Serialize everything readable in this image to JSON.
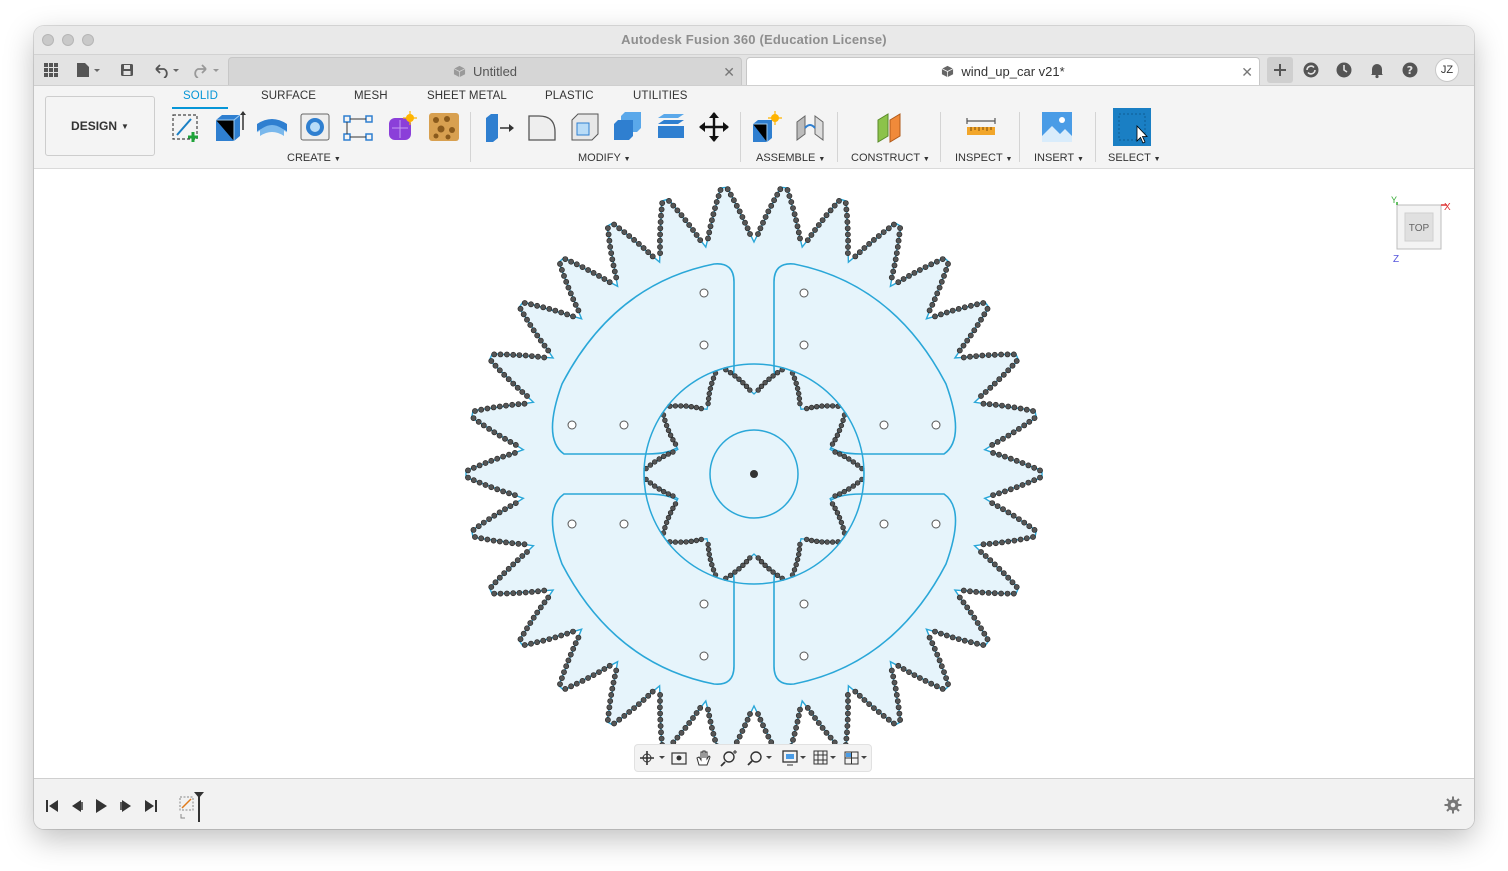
{
  "window": {
    "title": "Autodesk Fusion 360 (Education License)"
  },
  "tabs": [
    {
      "label": "Untitled",
      "active": false
    },
    {
      "label": "wind_up_car v21*",
      "active": true
    }
  ],
  "user": {
    "initials": "JZ"
  },
  "workspace": {
    "label": "DESIGN"
  },
  "ribbon_tabs": [
    {
      "label": "SOLID",
      "active": true
    },
    {
      "label": "SURFACE",
      "active": false
    },
    {
      "label": "MESH",
      "active": false
    },
    {
      "label": "SHEET METAL",
      "active": false
    },
    {
      "label": "PLASTIC",
      "active": false
    },
    {
      "label": "UTILITIES",
      "active": false
    }
  ],
  "groups": {
    "create": "CREATE",
    "modify": "MODIFY",
    "assemble": "ASSEMBLE",
    "construct": "CONSTRUCT",
    "inspect": "INSPECT",
    "insert": "INSERT",
    "select": "SELECT"
  },
  "viewcube": {
    "face": "TOP",
    "axis_x": "X",
    "axis_y": "Y",
    "axis_z": "Z"
  },
  "colors": {
    "accent": "#0696d7",
    "gear_fill": "#e6f4fb",
    "gear_stroke": "#2aa7d8",
    "select_blue": "#1a7fc4"
  },
  "icons": {
    "apps": "apps-grid-icon",
    "file": "file-icon",
    "save": "save-icon",
    "undo": "undo-icon",
    "redo": "redo-icon",
    "new_tab": "plus-icon",
    "extensions": "extensions-icon",
    "job_status": "clock-icon",
    "notifications": "bell-icon",
    "help": "help-icon",
    "settings": "gear-icon"
  }
}
